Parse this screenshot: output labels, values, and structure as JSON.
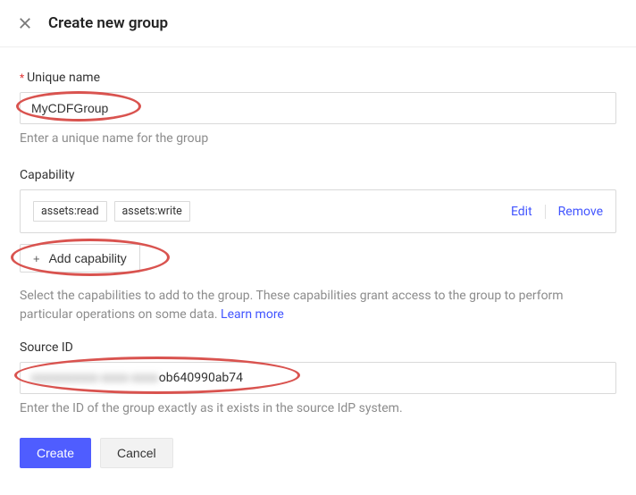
{
  "header": {
    "title": "Create new group"
  },
  "uniqueName": {
    "label": "Unique name",
    "value": "MyCDFGroup",
    "helper": "Enter a unique name for the group"
  },
  "capability": {
    "label": "Capability",
    "tags": [
      "assets:read",
      "assets:write"
    ],
    "editLabel": "Edit",
    "removeLabel": "Remove",
    "addButton": "Add capability",
    "helperPrefix": "Select the capabilities to add to the group. These capabilities grant access to the group to perform particular operations on some data. ",
    "learnMore": "Learn more"
  },
  "sourceId": {
    "label": "Source ID",
    "visibleSuffix": "ob640990ab74",
    "obscuredPlaceholder": "xxxxxxxxxx-xxxx-xxxx",
    "helper": "Enter the ID of the group exactly as it exists in the source IdP system."
  },
  "footer": {
    "create": "Create",
    "cancel": "Cancel"
  }
}
